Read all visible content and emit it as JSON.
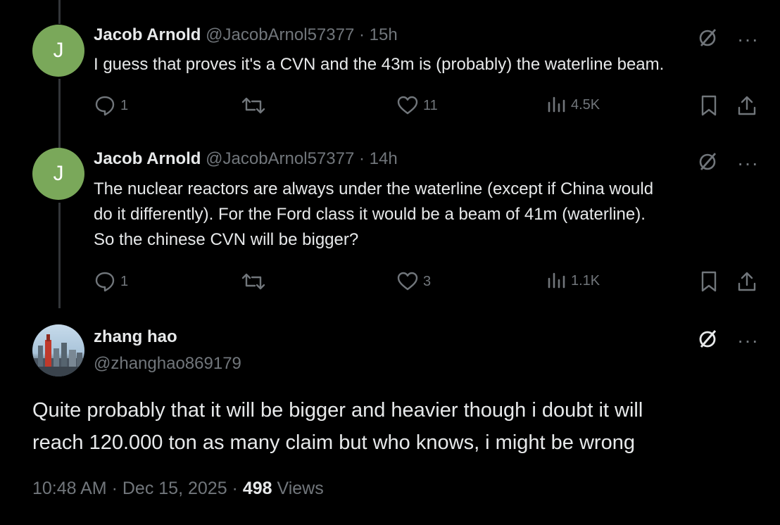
{
  "tweets": [
    {
      "avatar_letter": "J",
      "avatar_color": "#7aa85a",
      "name": "Jacob Arnold",
      "handle": "@JacobArnol57377",
      "time": "15h",
      "text": "I guess that proves it's a CVN and the 43m is (probably) the waterline beam.",
      "replies": "1",
      "likes": "11",
      "views": "4.5K"
    },
    {
      "avatar_letter": "J",
      "avatar_color": "#7aa85a",
      "name": "Jacob Arnold",
      "handle": "@JacobArnol57377",
      "time": "14h",
      "text_lines": [
        "The nuclear reactors are always under the waterline (except if China would",
        "do it differently). For the Ford class it would be a beam of 41m (waterline).",
        "So the chinese CVN will be bigger?"
      ],
      "replies": "1",
      "likes": "3",
      "views": "1.1K"
    }
  ],
  "main_tweet": {
    "name": "zhang hao",
    "handle": "@zhanghao869179",
    "text_lines": [
      "Quite probably that it will be bigger and heavier though i doubt it will",
      "reach 120.000 ton as many claim but who knows, i might be wrong"
    ],
    "time": "10:48 AM",
    "date": "Dec 15, 2025",
    "views_count": "498",
    "views_label": "Views"
  },
  "icons": {
    "reply": "reply-icon",
    "retweet": "retweet-icon",
    "like": "heart-icon",
    "views": "views-chart-icon",
    "bookmark": "bookmark-icon",
    "share": "share-icon",
    "grok": "grok-icon",
    "more": "more-icon"
  },
  "colors": {
    "background": "#000000",
    "text": "#e7e9ea",
    "muted": "#71767b",
    "thread_line": "#333639"
  }
}
